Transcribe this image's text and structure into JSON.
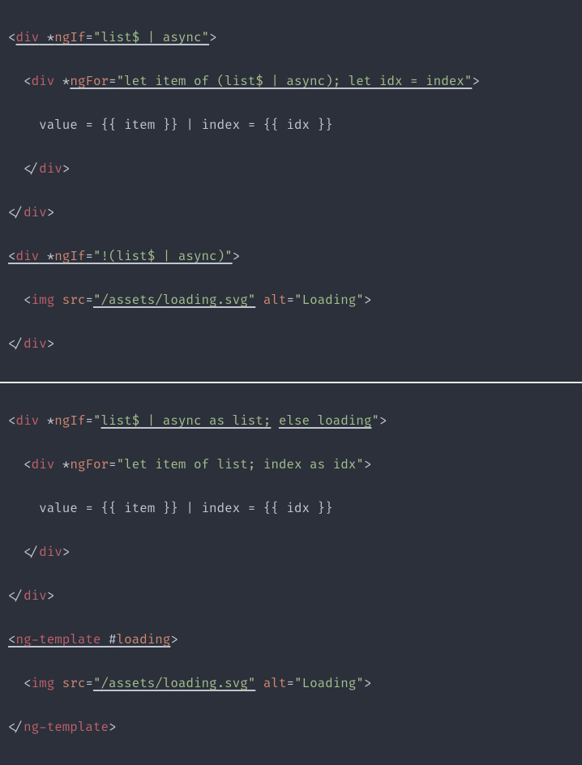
{
  "block1": {
    "l1": {
      "a": "<",
      "b": "div",
      "c": " *",
      "d": "ngIf",
      "e": "=",
      "f": "\"list$ | async\"",
      "g": ">"
    },
    "l2": {
      "indent": "  ",
      "a": "<",
      "b": "div",
      "c": " *",
      "d": "ngFor",
      "e": "=",
      "f": "\"let item of (list$ | async); let idx = index\"",
      "g": ">"
    },
    "l3": {
      "indent": "    ",
      "txt": "value = {{ item }} | index = {{ idx }}"
    },
    "l4": {
      "indent": "  ",
      "a": "</",
      "b": "div",
      "c": ">"
    },
    "l5": {
      "a": "</",
      "b": "div",
      "c": ">"
    },
    "l6": {
      "a": "<",
      "b": "div",
      "c": " *",
      "d": "ngIf",
      "e": "=",
      "f": "\"!(list$ | async)\"",
      "g": ">"
    },
    "l7": {
      "indent": "  ",
      "a": "<",
      "b": "img",
      "c": " ",
      "d": "src",
      "e": "=",
      "f": "\"/assets/loading.svg\"",
      "g": " ",
      "h": "alt",
      "i": "=",
      "j": "\"Loading\"",
      "k": ">"
    },
    "l8": {
      "a": "</",
      "b": "div",
      "c": ">"
    }
  },
  "block2": {
    "l1": {
      "a": "<",
      "b": "div",
      "c": " *",
      "d": "ngIf",
      "e": "=",
      "f1": "\"",
      "f2": "list$ | async as list;",
      "f3": " ",
      "f4": "else loading",
      "f5": "\"",
      "g": ">"
    },
    "l2": {
      "indent": "  ",
      "a": "<",
      "b": "div",
      "c": " *",
      "d": "ngFor",
      "e": "=",
      "f": "\"let item of list; index as idx\"",
      "g": ">"
    },
    "l3": {
      "indent": "    ",
      "txt": "value = {{ item }} | index = {{ idx }}"
    },
    "l4": {
      "indent": "  ",
      "a": "</",
      "b": "div",
      "c": ">"
    },
    "l5": {
      "a": "</",
      "b": "div",
      "c": ">"
    },
    "l6": {
      "a": "<",
      "b": "ng-template",
      "c": " #",
      "d": "loading",
      "e": ">"
    },
    "l7": {
      "indent": "  ",
      "a": "<",
      "b": "img",
      "c": " ",
      "d": "src",
      "e": "=",
      "f": "\"/assets/loading.svg\"",
      "g": " ",
      "h": "alt",
      "i": "=",
      "j": "\"Loading\"",
      "k": ">"
    },
    "l8": {
      "a": "</",
      "b": "ng-template",
      "c": ">"
    }
  }
}
